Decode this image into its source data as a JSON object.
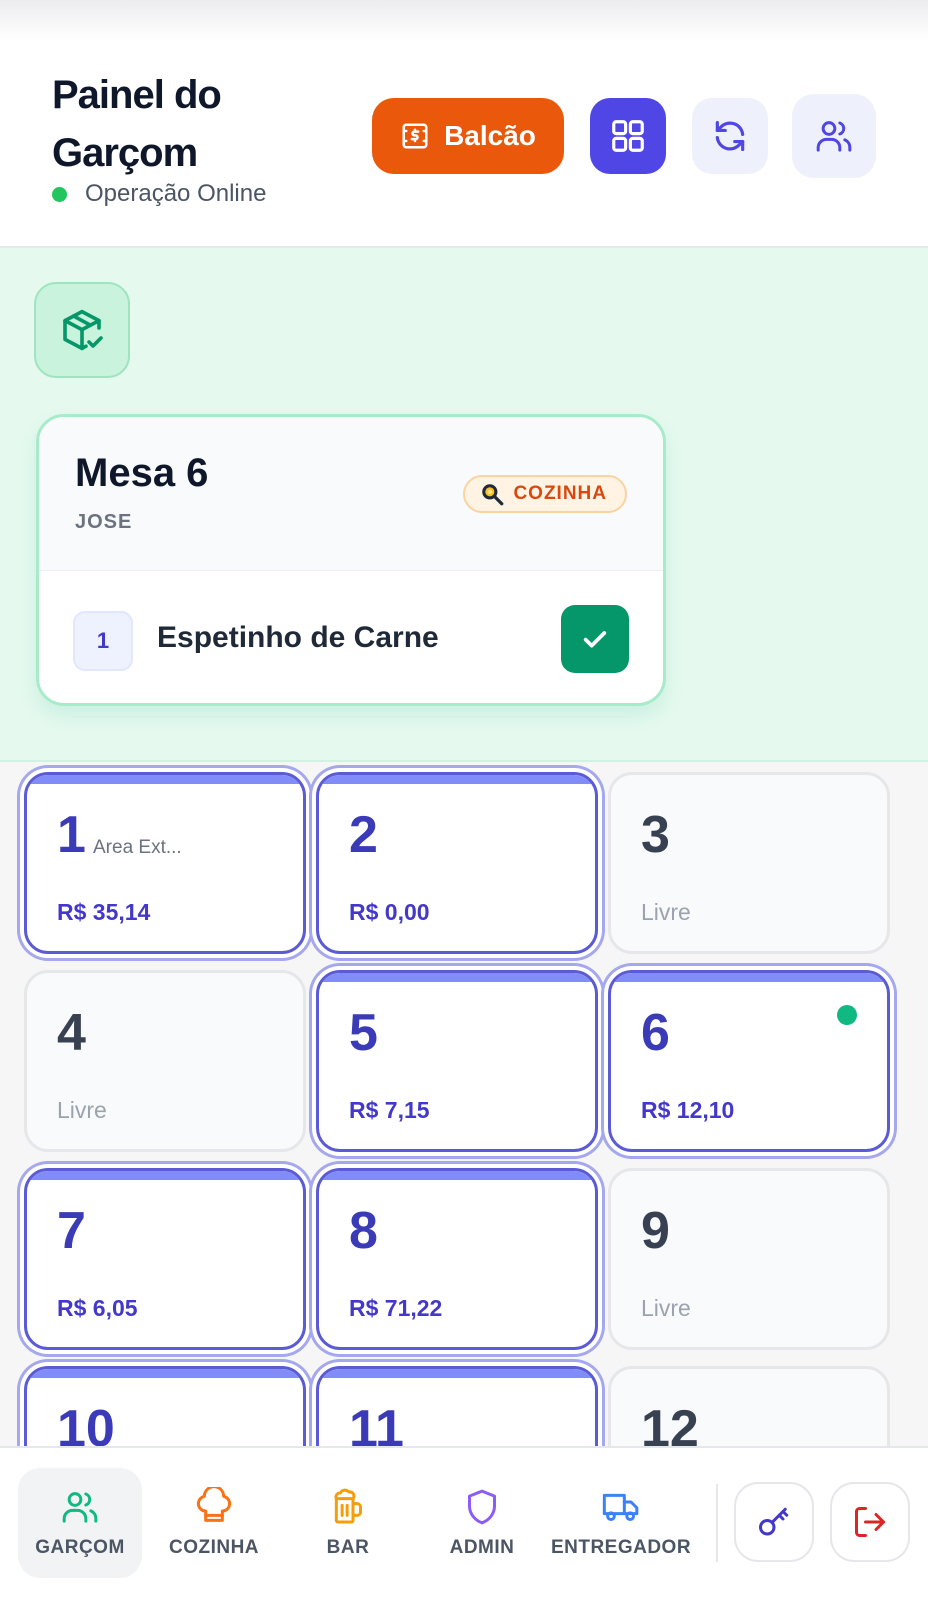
{
  "header": {
    "title": "Painel do Garçom",
    "status_text": "Operação Online",
    "balcao_label": "Balcão"
  },
  "ready_order": {
    "title": "Mesa 6",
    "customer": "JOSE",
    "badge": "COZINHA",
    "items": [
      {
        "qty": "1",
        "name": "Espetinho de Carne"
      }
    ]
  },
  "tables": [
    {
      "number": "1",
      "area": "Area Ext...",
      "value": "R$ 35,14",
      "status": "occupied"
    },
    {
      "number": "2",
      "area": "",
      "value": "R$ 0,00",
      "status": "occupied"
    },
    {
      "number": "3",
      "area": "",
      "value": "Livre",
      "status": "free"
    },
    {
      "number": "4",
      "area": "",
      "value": "Livre",
      "status": "free"
    },
    {
      "number": "5",
      "area": "",
      "value": "R$ 7,15",
      "status": "occupied"
    },
    {
      "number": "6",
      "area": "",
      "value": "R$ 12,10",
      "status": "occupied",
      "ready": true
    },
    {
      "number": "7",
      "area": "",
      "value": "R$ 6,05",
      "status": "occupied"
    },
    {
      "number": "8",
      "area": "",
      "value": "R$ 71,22",
      "status": "occupied"
    },
    {
      "number": "9",
      "area": "",
      "value": "Livre",
      "status": "free"
    },
    {
      "number": "10",
      "area": "",
      "value": "",
      "status": "occupied"
    },
    {
      "number": "11",
      "area": "",
      "value": "",
      "status": "occupied"
    },
    {
      "number": "12",
      "area": "",
      "value": "",
      "status": "free"
    }
  ],
  "bottom_nav": {
    "items": [
      {
        "label": "GARÇOM",
        "icon": "users-icon",
        "color": "#10b981",
        "active": true
      },
      {
        "label": "COZINHA",
        "icon": "chef-hat-icon",
        "color": "#f97316"
      },
      {
        "label": "BAR",
        "icon": "beer-icon",
        "color": "#f59e0b"
      },
      {
        "label": "ADMIN",
        "icon": "shield-icon",
        "color": "#8b5cf6"
      },
      {
        "label": "ENTREGADOR",
        "icon": "truck-icon",
        "color": "#3b82f6"
      }
    ],
    "actions": [
      {
        "icon": "key-icon",
        "color": "#4338ca"
      },
      {
        "icon": "logout-icon",
        "color": "#dc2626"
      }
    ]
  },
  "colors": {
    "primary": "#4f46e5",
    "balcao": "#ea580c",
    "success": "#059669",
    "online": "#22c55e"
  }
}
